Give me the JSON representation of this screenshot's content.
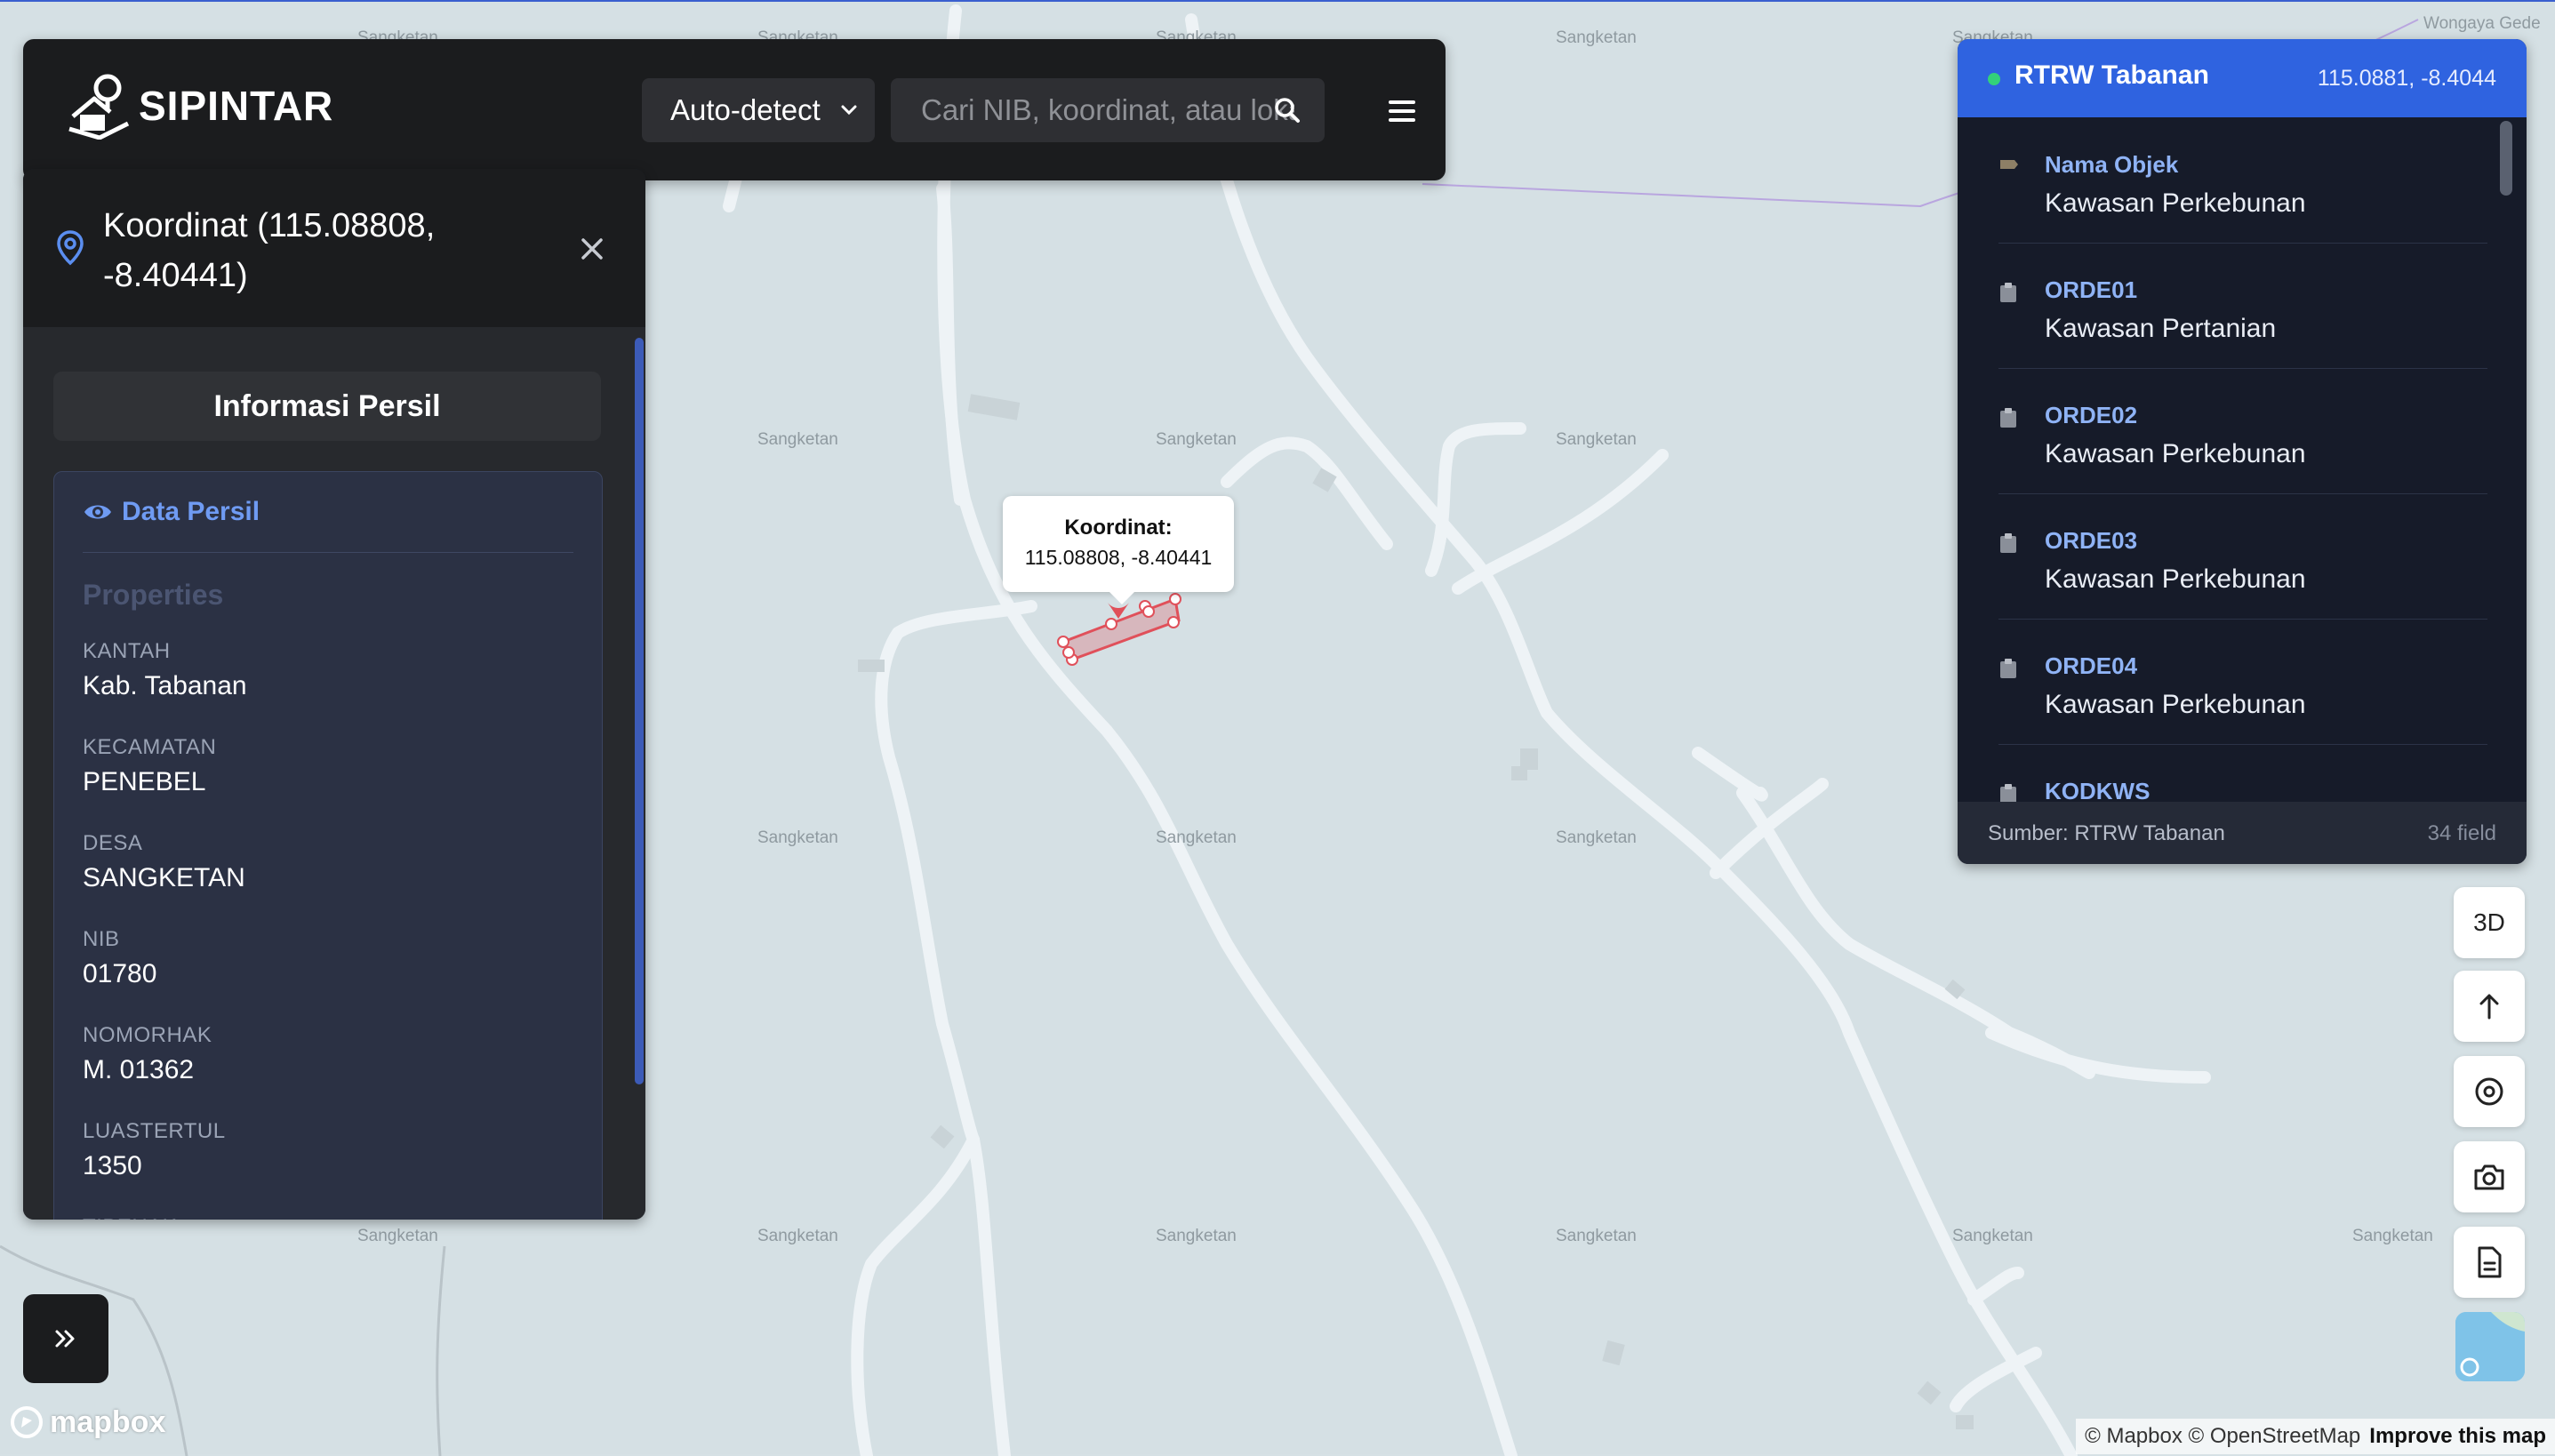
{
  "app": {
    "name": "SIPINTAR"
  },
  "header": {
    "mode_value": "Auto-detect",
    "search_placeholder": "Cari NIB, koordinat, atau lokasi"
  },
  "map": {
    "place_labels": [
      "Sangketan",
      "Sangketan",
      "Sangketan",
      "Sangketan",
      "Sangketan",
      "Wongaya Gede",
      "Sangketan",
      "Sangketan",
      "Sangketan",
      "Sangketan",
      "Sangketan",
      "Sangketan",
      "Sangketan",
      "Sangketan",
      "Sangketan",
      "Sangketan",
      "Sangketan",
      "Sangketan"
    ],
    "popup": {
      "title": "Koordinat:",
      "coord": "115.08808, -8.40441"
    },
    "controls": {
      "pitch_label": "3D"
    },
    "logo_text": "mapbox",
    "attribution": {
      "copyright": "© Mapbox © OpenStreetMap",
      "improve": "Improve this map"
    },
    "parcel_color": "#e0505a"
  },
  "left_panel": {
    "title": "Koordinat (115.08808, -8.40441)",
    "info_button": "Informasi Persil",
    "section_title": "Data Persil",
    "properties_label": "Properties",
    "properties": [
      {
        "key": "KANTAH",
        "value": "Kab. Tabanan"
      },
      {
        "key": "KECAMATAN",
        "value": "PENEBEL"
      },
      {
        "key": "DESA",
        "value": "SANGKETAN"
      },
      {
        "key": "NIB",
        "value": "01780"
      },
      {
        "key": "NOMORHAK",
        "value": "M. 01362"
      },
      {
        "key": "LUASTERTUL",
        "value": "1350"
      },
      {
        "key": "TIPEHAK",
        "value": ""
      }
    ]
  },
  "right_panel": {
    "title": "RTRW Tabanan",
    "coord": "115.0881, -8.4044",
    "items": [
      {
        "key": "Nama Objek",
        "value": "Kawasan Perkebunan",
        "icon": "tag-icon"
      },
      {
        "key": "ORDE01",
        "value": "Kawasan Pertanian",
        "icon": "clipboard-icon"
      },
      {
        "key": "ORDE02",
        "value": "Kawasan Perkebunan",
        "icon": "clipboard-icon"
      },
      {
        "key": "ORDE03",
        "value": "Kawasan Perkebunan",
        "icon": "clipboard-icon"
      },
      {
        "key": "ORDE04",
        "value": "Kawasan Perkebunan",
        "icon": "clipboard-icon"
      },
      {
        "key": "KODKWS",
        "value": "",
        "icon": "clipboard-icon"
      }
    ],
    "source": "Sumber: RTRW Tabanan",
    "field_count": "34 field"
  },
  "colors": {
    "accent": "#2f63e0",
    "link": "#6f9bf3",
    "status_dot": "#33d17a"
  }
}
